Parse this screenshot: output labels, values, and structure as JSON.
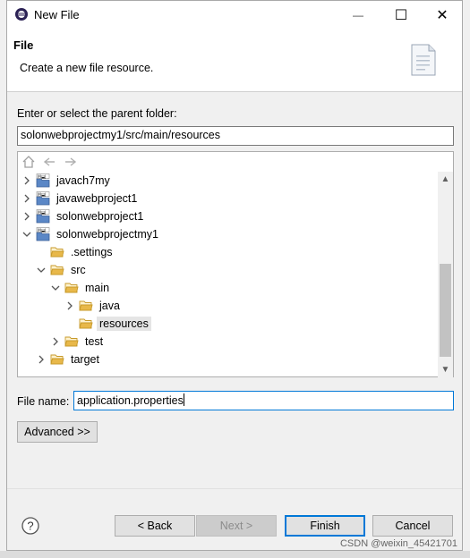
{
  "window": {
    "title": "New File",
    "minimize_glyph": "—",
    "maximize_glyph": "☐",
    "close_glyph": "✕"
  },
  "banner": {
    "title": "File",
    "description": "Create a new file resource."
  },
  "parent_folder": {
    "label": "Enter or select the parent folder:",
    "value": "solonwebprojectmy1/src/main/resources"
  },
  "tree": {
    "items": [
      {
        "label": "javach7my",
        "type": "project",
        "expanded": false,
        "depth": 0
      },
      {
        "label": "javawebproject1",
        "type": "project",
        "expanded": false,
        "depth": 0
      },
      {
        "label": "solonwebproject1",
        "type": "project",
        "expanded": false,
        "depth": 0
      },
      {
        "label": "solonwebprojectmy1",
        "type": "project",
        "expanded": true,
        "depth": 0
      },
      {
        "label": ".settings",
        "type": "folder",
        "expanded": null,
        "depth": 1
      },
      {
        "label": "src",
        "type": "folder",
        "expanded": true,
        "depth": 1
      },
      {
        "label": "main",
        "type": "folder",
        "expanded": true,
        "depth": 2
      },
      {
        "label": "java",
        "type": "folder",
        "expanded": false,
        "depth": 3
      },
      {
        "label": "resources",
        "type": "folder",
        "expanded": null,
        "depth": 3,
        "selected": true
      },
      {
        "label": "test",
        "type": "folder",
        "expanded": false,
        "depth": 2
      },
      {
        "label": "target",
        "type": "folder",
        "expanded": false,
        "depth": 1
      }
    ]
  },
  "file_name": {
    "label": "File name:",
    "value": "application.properties"
  },
  "buttons": {
    "advanced": "Advanced >>",
    "back": "< Back",
    "next": "Next >",
    "finish": "Finish",
    "cancel": "Cancel"
  },
  "watermark": "CSDN @weixin_45421701",
  "colors": {
    "accent": "#0078d7",
    "folder": "#e8b84a",
    "selection": "#e5e5e5"
  }
}
